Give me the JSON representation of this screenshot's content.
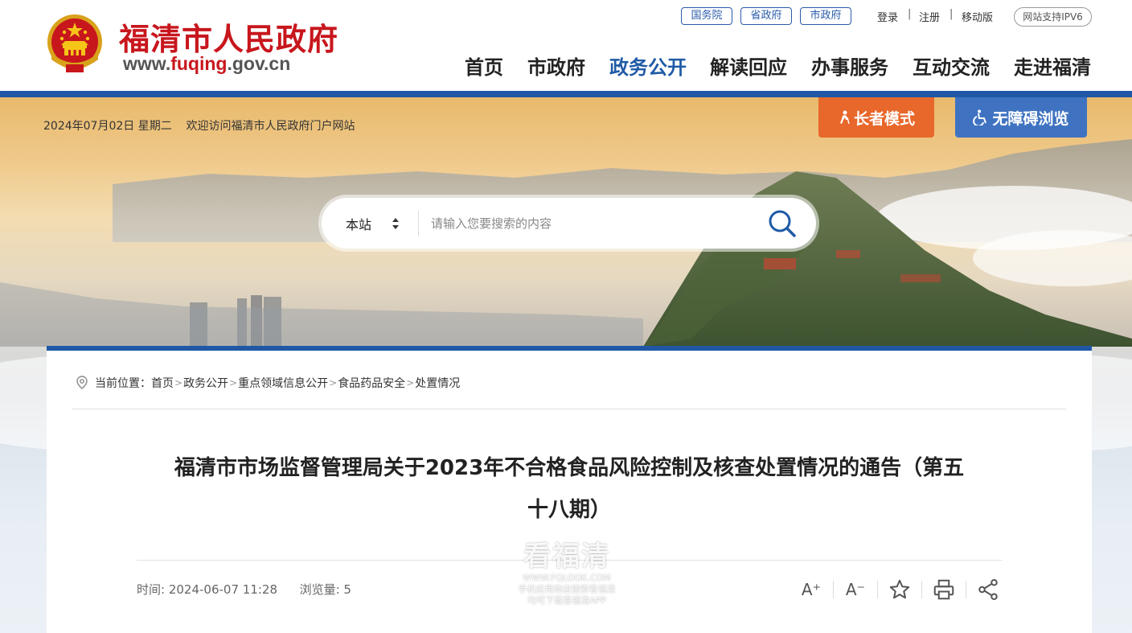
{
  "header": {
    "site_name": "福清市人民政府",
    "site_url_prefix": "www.",
    "site_url_accent": "fuqing",
    "site_url_suffix": ".gov.cn",
    "top_tags": [
      "国务院",
      "省政府",
      "市政府"
    ],
    "top_links": {
      "login": "登录",
      "register": "注册",
      "mobile": "移动版",
      "separator": "|"
    },
    "ipv6_badge": "网站支持IPV6",
    "nav": [
      "首页",
      "市政府",
      "政务公开",
      "解读回应",
      "办事服务",
      "互动交流",
      "走进福清"
    ],
    "nav_active_index": 2
  },
  "banner": {
    "date": "2024年07月02日",
    "weekday": "星期二",
    "welcome": "欢迎访问福清市人民政府门户网站",
    "elder_mode": "长者模式",
    "accessible": "无障碍浏览",
    "search": {
      "scope": "本站",
      "placeholder": "请输入您要搜索的内容"
    }
  },
  "breadcrumb": {
    "label": "当前位置：",
    "items": [
      "首页",
      "政务公开",
      "重点领域信息公开",
      "食品药品安全",
      "处置情况"
    ],
    "separator": ">"
  },
  "article": {
    "title_line1": "福清市市场监督管理局关于2023年不合格食品风险控制及核查处置情况的通告（第五",
    "title_line2": "十八期）",
    "time_label": "时间:",
    "time_value": "2024-06-07 11:28",
    "views_label": "浏览量:",
    "views_value": "5",
    "tools": [
      "A⁺",
      "A⁻"
    ]
  },
  "watermark": {
    "title": "看福清",
    "url": "WWW.FQLOOK.COM",
    "line1": "手机应用商店搜索看福清",
    "line2": "均可下载看福清APP"
  },
  "colors": {
    "brand_red": "#c8161d",
    "brand_blue": "#2058a6",
    "nav_active": "#1f5aa6",
    "elder_orange": "#e8672a",
    "access_blue": "#3f73c1"
  }
}
